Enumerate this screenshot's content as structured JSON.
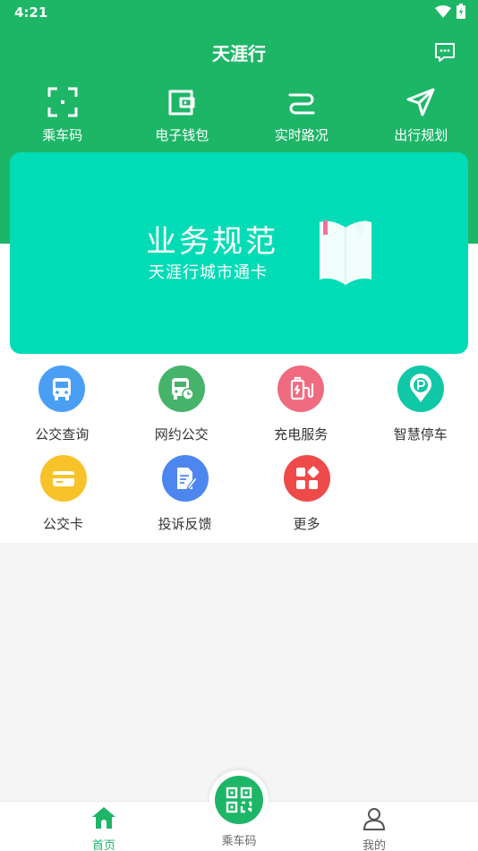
{
  "status": {
    "time": "4:21"
  },
  "header": {
    "title": "天涯行"
  },
  "quick_actions": [
    {
      "label": "乘车码",
      "icon": "scan-icon"
    },
    {
      "label": "电子钱包",
      "icon": "wallet-icon"
    },
    {
      "label": "实时路况",
      "icon": "route-icon"
    },
    {
      "label": "出行规划",
      "icon": "navigation-icon"
    }
  ],
  "banner": {
    "title": "业务规范",
    "subtitle": "天涯行城市通卡"
  },
  "services": [
    {
      "label": "公交查询",
      "icon": "bus-icon",
      "color": "#4a9ff5"
    },
    {
      "label": "网约公交",
      "icon": "bus-clock-icon",
      "color": "#46b36a"
    },
    {
      "label": "充电服务",
      "icon": "charging-icon",
      "color": "#f06b80"
    },
    {
      "label": "智慧停车",
      "icon": "parking-icon",
      "color": "#10c7a7"
    },
    {
      "label": "公交卡",
      "icon": "card-icon",
      "color": "#f7c22a"
    },
    {
      "label": "投诉反馈",
      "icon": "feedback-icon",
      "color": "#4d86ef"
    },
    {
      "label": "更多",
      "icon": "more-apps-icon",
      "color": "#ef4a4a"
    }
  ],
  "tabbar": {
    "home": "首页",
    "ride_code": "乘车码",
    "mine": "我的"
  },
  "colors": {
    "brand": "#1db667",
    "banner": "#02dcb6"
  }
}
